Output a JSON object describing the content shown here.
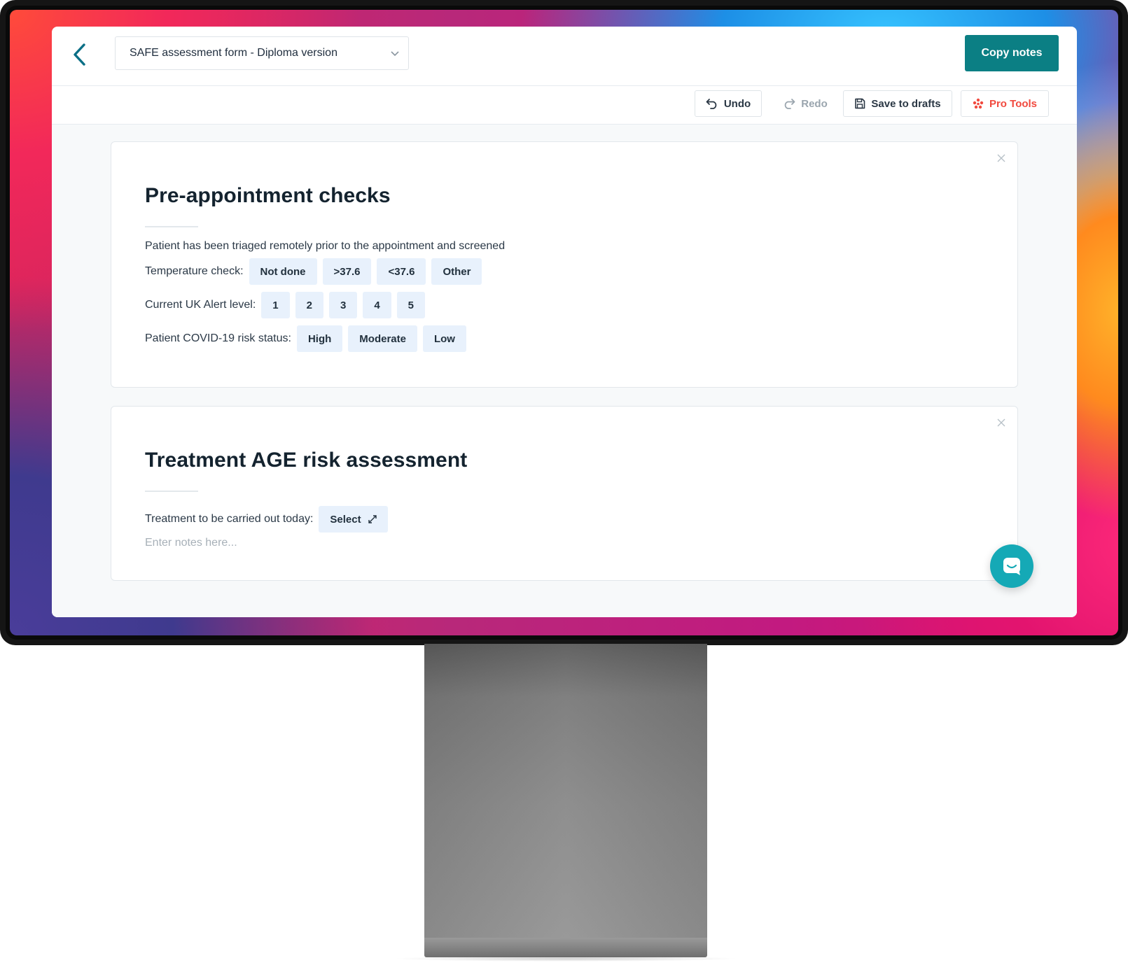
{
  "header": {
    "form_selector_value": "SAFE assessment form - Diploma version",
    "copy_notes_label": "Copy notes"
  },
  "toolbar": {
    "undo_label": "Undo",
    "redo_label": "Redo",
    "save_label": "Save to drafts",
    "pro_tools_label": "Pro Tools"
  },
  "sections": [
    {
      "title": "Pre-appointment checks",
      "statement": "Patient has been triaged remotely prior to the appointment and screened",
      "temperature": {
        "label": "Temperature check:",
        "options": [
          "Not done",
          ">37.6",
          "<37.6",
          "Other"
        ]
      },
      "alert": {
        "label": "Current UK Alert level:",
        "options": [
          "1",
          "2",
          "3",
          "4",
          "5"
        ]
      },
      "risk": {
        "label": "Patient COVID-19 risk status:",
        "options": [
          "High",
          "Moderate",
          "Low"
        ]
      }
    },
    {
      "title": "Treatment AGE risk assessment",
      "treatment_label": "Treatment to be carried out today:",
      "select_label": "Select",
      "notes_placeholder": "Enter notes here..."
    }
  ],
  "colors": {
    "accent": "#0b7f84",
    "chip_bg": "#e8f1fc",
    "pro_tools": "#f1493e",
    "chat": "#15a9b6"
  },
  "icons": [
    "back-arrow-icon",
    "chevron-down-icon",
    "undo-icon",
    "redo-icon",
    "save-icon",
    "pro-tools-icon",
    "close-icon",
    "expand-icon",
    "chat-icon"
  ]
}
